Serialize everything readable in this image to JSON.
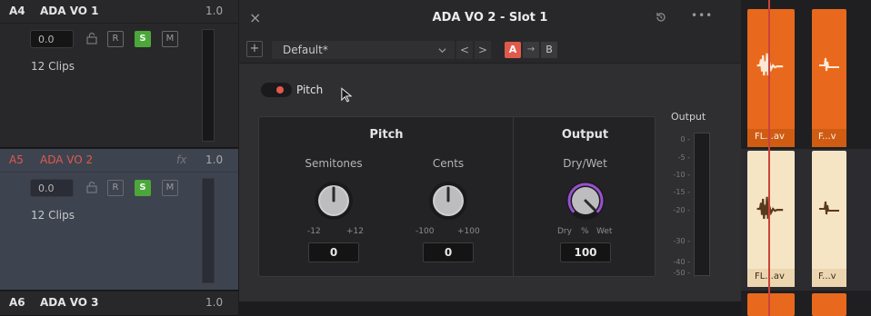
{
  "tracks": [
    {
      "id": "A4",
      "name": "ADA VO 1",
      "fx": "",
      "volume": "1.0",
      "level": "0.0",
      "clips_count": "12 Clips",
      "r_label": "R",
      "s_label": "S",
      "m_label": "M"
    },
    {
      "id": "A5",
      "name": "ADA VO 2",
      "fx": "fx",
      "volume": "1.0",
      "level": "0.0",
      "clips_count": "12 Clips",
      "r_label": "R",
      "s_label": "S",
      "m_label": "M"
    },
    {
      "id": "A6",
      "name": "ADA VO 3",
      "volume": "1.0"
    }
  ],
  "plugin": {
    "title": "ADA VO 2 - Slot 1",
    "close": "×",
    "menu": "•••",
    "add": "+",
    "preset": "Default*",
    "prev": "<",
    "next": ">",
    "a_label": "A",
    "arrow": "→",
    "b_label": "B",
    "toggle_label": "Pitch",
    "pitch_section": {
      "heading": "Pitch",
      "semitones": {
        "label": "Semitones",
        "min": "-12",
        "max": "+12",
        "value": "0"
      },
      "cents": {
        "label": "Cents",
        "min": "-100",
        "max": "+100",
        "value": "0"
      }
    },
    "output_section": {
      "heading": "Output",
      "drywet": {
        "label": "Dry/Wet",
        "dry": "Dry",
        "unit": "%",
        "wet": "Wet",
        "value": "100",
        "level": 1.0
      }
    },
    "meter": {
      "label": "Output",
      "ticks": [
        "0",
        "-5",
        "-10",
        "-15",
        "-20",
        "-30",
        "-40",
        "-50"
      ]
    }
  },
  "timeline_clips": {
    "top": [
      "FL...av",
      "F...v"
    ],
    "bottom": [
      "FL...av",
      "F...v"
    ]
  },
  "colors": {
    "accent_red": "#e05a4c",
    "solo_green": "#4da63a",
    "clip_orange": "#e8691d",
    "clip_cream": "#f6e5c5",
    "knob_ring_purple": "#9a4fd0"
  }
}
